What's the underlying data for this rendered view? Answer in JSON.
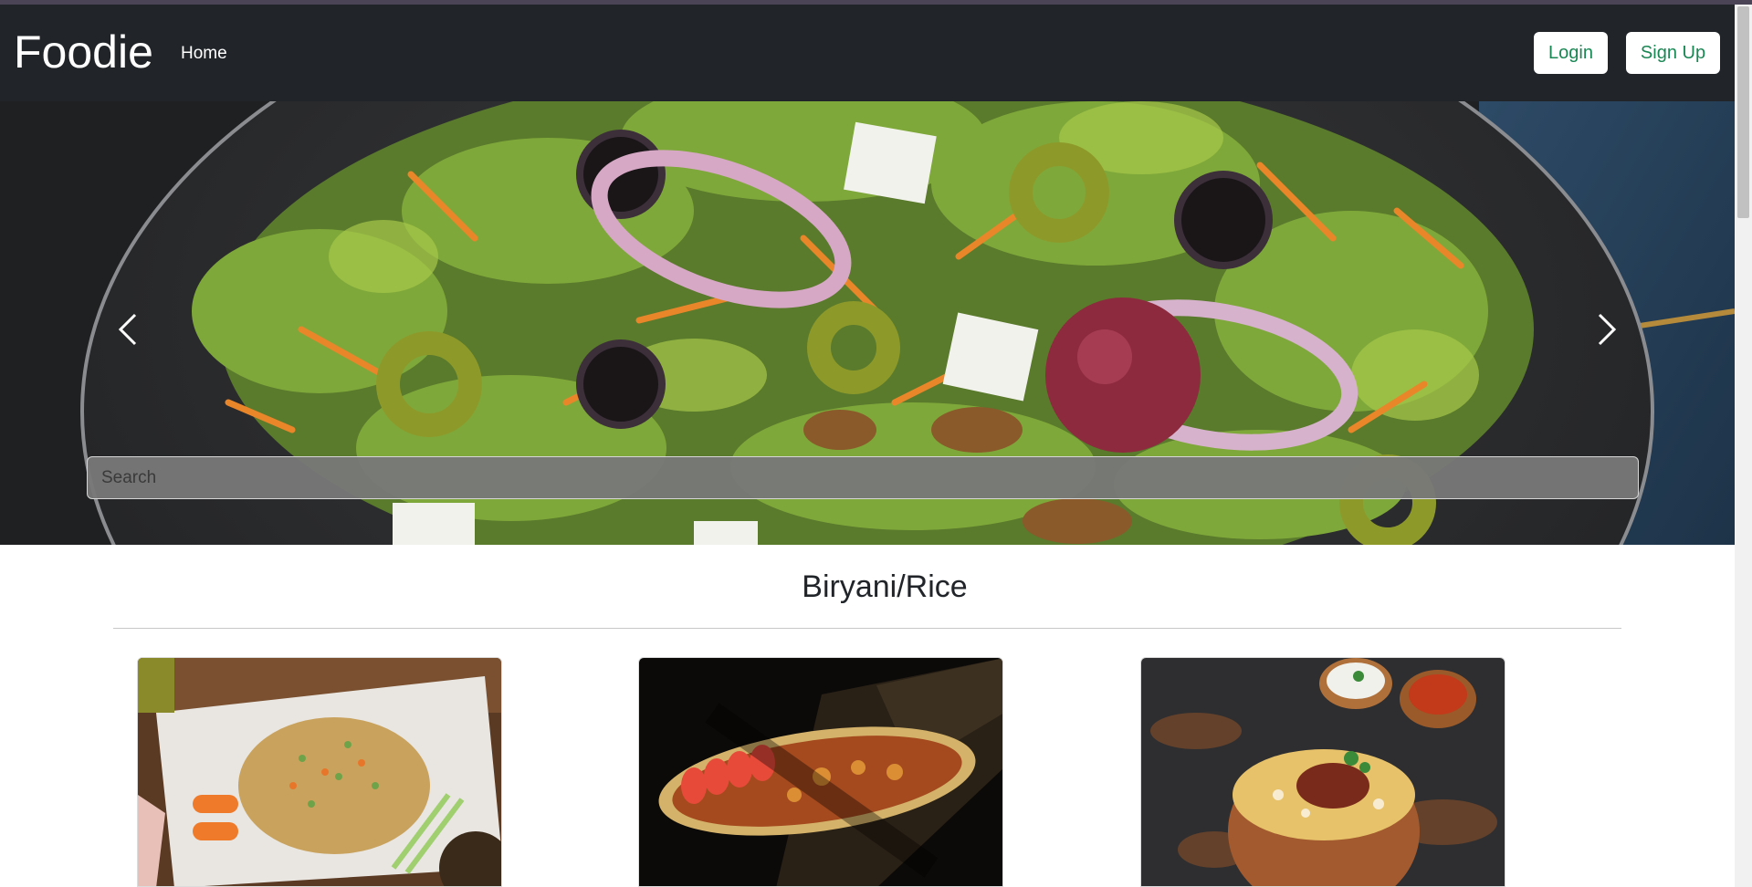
{
  "navbar": {
    "brand": "Foodie",
    "home_label": "Home",
    "login_label": "Login",
    "signup_label": "Sign Up"
  },
  "hero": {
    "image": "salad-photo",
    "prev_icon": "chevron-left-icon",
    "next_icon": "chevron-right-icon",
    "search_placeholder": "Search"
  },
  "section": {
    "title": "Biryani/Rice",
    "cards": [
      {
        "image": "fried-rice-photo"
      },
      {
        "image": "biryani-platter-photo"
      },
      {
        "image": "biryani-bowl-photo"
      }
    ]
  },
  "colors": {
    "navbar_bg": "#212529",
    "button_text": "#198754"
  }
}
